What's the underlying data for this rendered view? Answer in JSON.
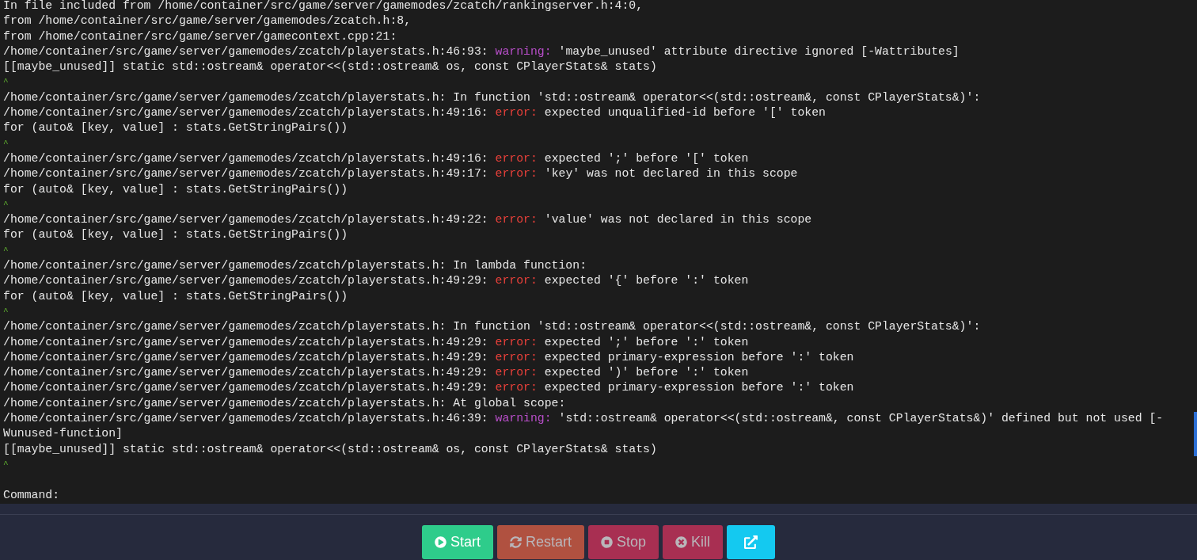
{
  "console": {
    "lines": [
      {
        "kind": "plain",
        "text": "In file included from /home/container/src/game/server/gamemodes/zcatch/rankingserver.h:4:0,"
      },
      {
        "kind": "plain",
        "text": "from /home/container/src/game/server/gamemodes/zcatch.h:8,"
      },
      {
        "kind": "plain",
        "text": "from /home/container/src/game/server/gamecontext.cpp:21:"
      },
      {
        "kind": "warning",
        "location": "/home/container/src/game/server/gamemodes/zcatch/playerstats.h:46:93:",
        "label": "warning:",
        "message": "'maybe_unused' attribute directive ignored [-Wattributes]"
      },
      {
        "kind": "plain",
        "text": "[[maybe_unused]] static std::ostream& operator<<(std::ostream& os, const CPlayerStats& stats)"
      },
      {
        "kind": "caret",
        "text": "^"
      },
      {
        "kind": "plain",
        "text": "/home/container/src/game/server/gamemodes/zcatch/playerstats.h: In function 'std::ostream& operator<<(std::ostream&, const CPlayerStats&)':"
      },
      {
        "kind": "error",
        "location": "/home/container/src/game/server/gamemodes/zcatch/playerstats.h:49:16:",
        "label": "error:",
        "message": "expected unqualified-id before '[' token"
      },
      {
        "kind": "plain",
        "text": "for (auto& [key, value] : stats.GetStringPairs())"
      },
      {
        "kind": "caret",
        "text": "^"
      },
      {
        "kind": "error",
        "location": "/home/container/src/game/server/gamemodes/zcatch/playerstats.h:49:16:",
        "label": "error:",
        "message": "expected ';' before '[' token"
      },
      {
        "kind": "error",
        "location": "/home/container/src/game/server/gamemodes/zcatch/playerstats.h:49:17:",
        "label": "error:",
        "message": "'key' was not declared in this scope"
      },
      {
        "kind": "plain",
        "text": "for (auto& [key, value] : stats.GetStringPairs())"
      },
      {
        "kind": "caret",
        "text": "^"
      },
      {
        "kind": "error",
        "location": "/home/container/src/game/server/gamemodes/zcatch/playerstats.h:49:22:",
        "label": "error:",
        "message": "'value' was not declared in this scope"
      },
      {
        "kind": "plain",
        "text": "for (auto& [key, value] : stats.GetStringPairs())"
      },
      {
        "kind": "caret",
        "text": "^"
      },
      {
        "kind": "plain",
        "text": "/home/container/src/game/server/gamemodes/zcatch/playerstats.h: In lambda function:"
      },
      {
        "kind": "error",
        "location": "/home/container/src/game/server/gamemodes/zcatch/playerstats.h:49:29:",
        "label": "error:",
        "message": "expected '{' before ':' token"
      },
      {
        "kind": "plain",
        "text": "for (auto& [key, value] : stats.GetStringPairs())"
      },
      {
        "kind": "caret",
        "text": "^"
      },
      {
        "kind": "plain",
        "text": "/home/container/src/game/server/gamemodes/zcatch/playerstats.h: In function 'std::ostream& operator<<(std::ostream&, const CPlayerStats&)':"
      },
      {
        "kind": "error",
        "location": "/home/container/src/game/server/gamemodes/zcatch/playerstats.h:49:29:",
        "label": "error:",
        "message": "expected ';' before ':' token"
      },
      {
        "kind": "error",
        "location": "/home/container/src/game/server/gamemodes/zcatch/playerstats.h:49:29:",
        "label": "error:",
        "message": "expected primary-expression before ':' token"
      },
      {
        "kind": "error",
        "location": "/home/container/src/game/server/gamemodes/zcatch/playerstats.h:49:29:",
        "label": "error:",
        "message": "expected ')' before ':' token"
      },
      {
        "kind": "error",
        "location": "/home/container/src/game/server/gamemodes/zcatch/playerstats.h:49:29:",
        "label": "error:",
        "message": "expected primary-expression before ':' token"
      },
      {
        "kind": "plain",
        "text": "/home/container/src/game/server/gamemodes/zcatch/playerstats.h: At global scope:"
      },
      {
        "kind": "warning",
        "location": "/home/container/src/game/server/gamemodes/zcatch/playerstats.h:46:39:",
        "label": "warning:",
        "message": "'std::ostream& operator<<(std::ostream&, const CPlayerStats&)' defined but not used [-Wunused-function]"
      },
      {
        "kind": "plain",
        "text": "[[maybe_unused]] static std::ostream& operator<<(std::ostream& os, const CPlayerStats& stats)"
      },
      {
        "kind": "caret",
        "text": "^"
      },
      {
        "kind": "blank"
      },
      {
        "kind": "plain",
        "text": "Command:"
      }
    ]
  },
  "buttons": [
    {
      "kind": "start",
      "label": "Start",
      "disabled": false
    },
    {
      "kind": "restart",
      "label": "Restart",
      "disabled": true
    },
    {
      "kind": "stop",
      "label": "Stop",
      "disabled": true
    },
    {
      "kind": "kill",
      "label": "Kill",
      "disabled": true
    },
    {
      "kind": "external",
      "disabled": false
    }
  ]
}
